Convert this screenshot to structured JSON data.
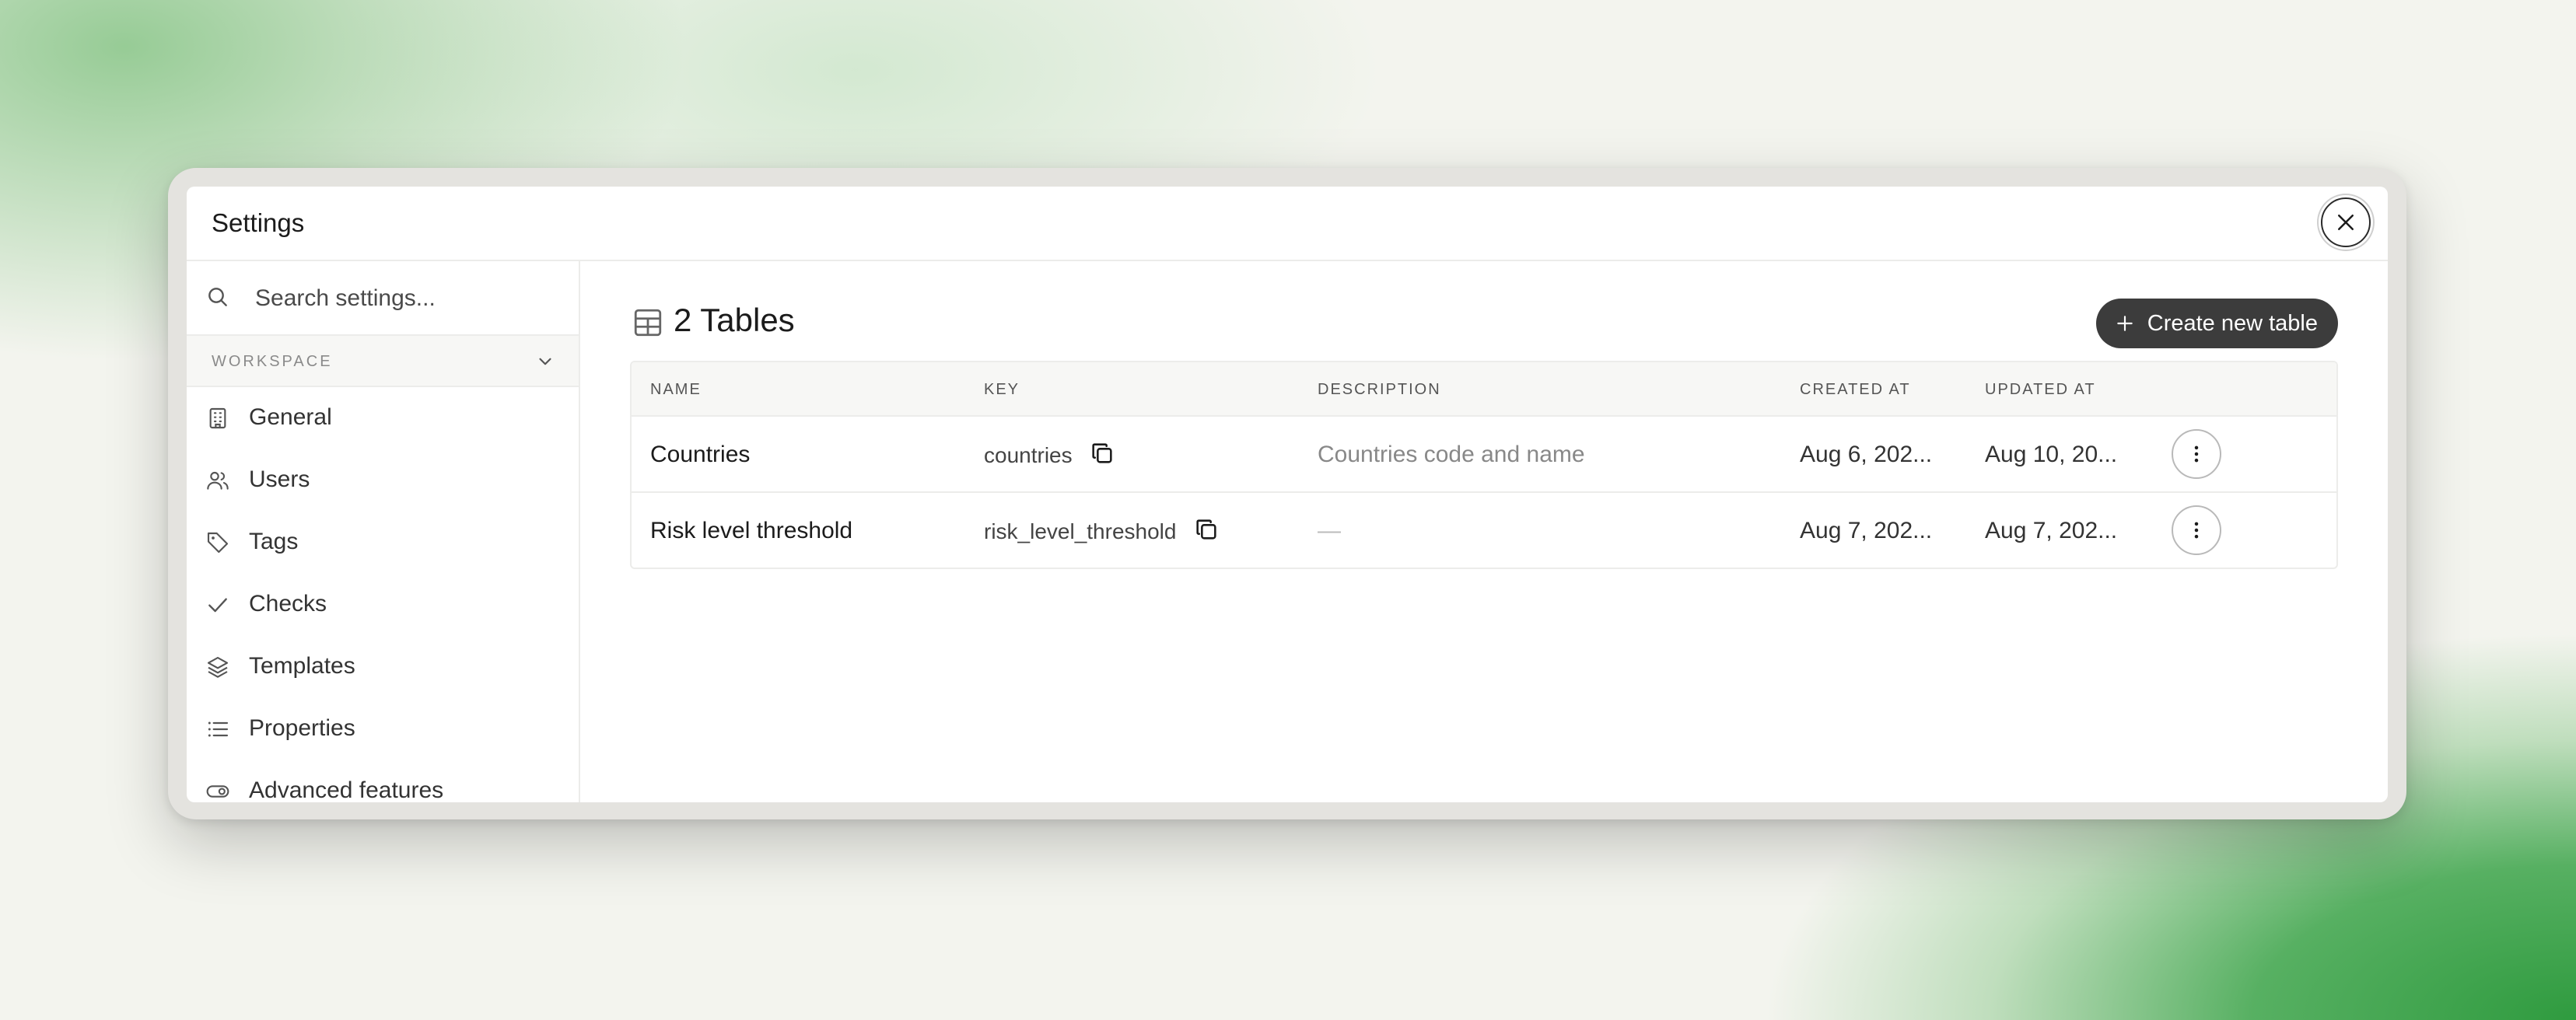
{
  "header": {
    "title": "Settings"
  },
  "search": {
    "placeholder": "Search settings..."
  },
  "sidebar": {
    "section_label": "WORKSPACE",
    "items": [
      {
        "label": "General",
        "icon": "building-icon"
      },
      {
        "label": "Users",
        "icon": "users-icon"
      },
      {
        "label": "Tags",
        "icon": "tag-icon"
      },
      {
        "label": "Checks",
        "icon": "check-icon"
      },
      {
        "label": "Templates",
        "icon": "layers-icon"
      },
      {
        "label": "Properties",
        "icon": "list-icon"
      },
      {
        "label": "Advanced features",
        "icon": "toggle-icon"
      }
    ]
  },
  "main": {
    "title": "2 Tables",
    "create_label": "Create new table",
    "columns": [
      "NAME",
      "KEY",
      "DESCRIPTION",
      "CREATED AT",
      "UPDATED AT"
    ],
    "rows": [
      {
        "name": "Countries",
        "key": "countries",
        "description": "Countries code and name",
        "created_at": "Aug 6, 202...",
        "updated_at": "Aug 10, 20..."
      },
      {
        "name": "Risk level threshold",
        "key": "risk_level_threshold",
        "description": "—",
        "created_at": "Aug 7, 202...",
        "updated_at": "Aug 7, 202..."
      }
    ]
  },
  "colors": {
    "accent_button": "#3c3c3c",
    "border": "#ececea",
    "muted_text": "#888888"
  }
}
